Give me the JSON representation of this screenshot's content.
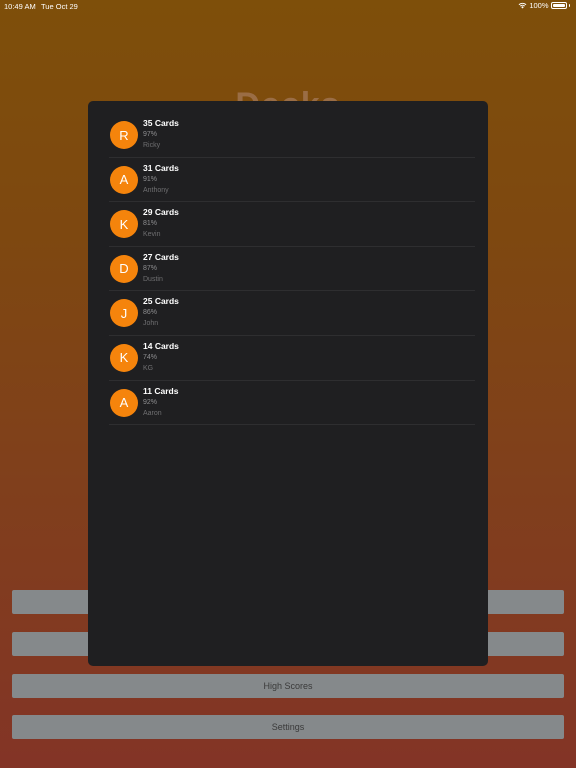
{
  "status_bar": {
    "time": "10:49 AM",
    "date": "Tue Oct 29",
    "battery": "100%"
  },
  "background": {
    "title": "Decks"
  },
  "menu": {
    "high_scores_label": "High Scores",
    "settings_label": "Settings"
  },
  "high_scores": [
    {
      "initial": "R",
      "cards": "35 Cards",
      "percent": "97%",
      "name": "Ricky"
    },
    {
      "initial": "A",
      "cards": "31 Cards",
      "percent": "91%",
      "name": "Anthony"
    },
    {
      "initial": "K",
      "cards": "29 Cards",
      "percent": "81%",
      "name": "Kevin"
    },
    {
      "initial": "D",
      "cards": "27 Cards",
      "percent": "87%",
      "name": "Dustin"
    },
    {
      "initial": "J",
      "cards": "25 Cards",
      "percent": "86%",
      "name": "John"
    },
    {
      "initial": "K",
      "cards": "14 Cards",
      "percent": "74%",
      "name": "KG"
    },
    {
      "initial": "A",
      "cards": "11 Cards",
      "percent": "92%",
      "name": "Aaron"
    }
  ],
  "colors": {
    "accent": "#f5840c",
    "modal_background": "#1f1f21",
    "button_background": "#85898b"
  }
}
